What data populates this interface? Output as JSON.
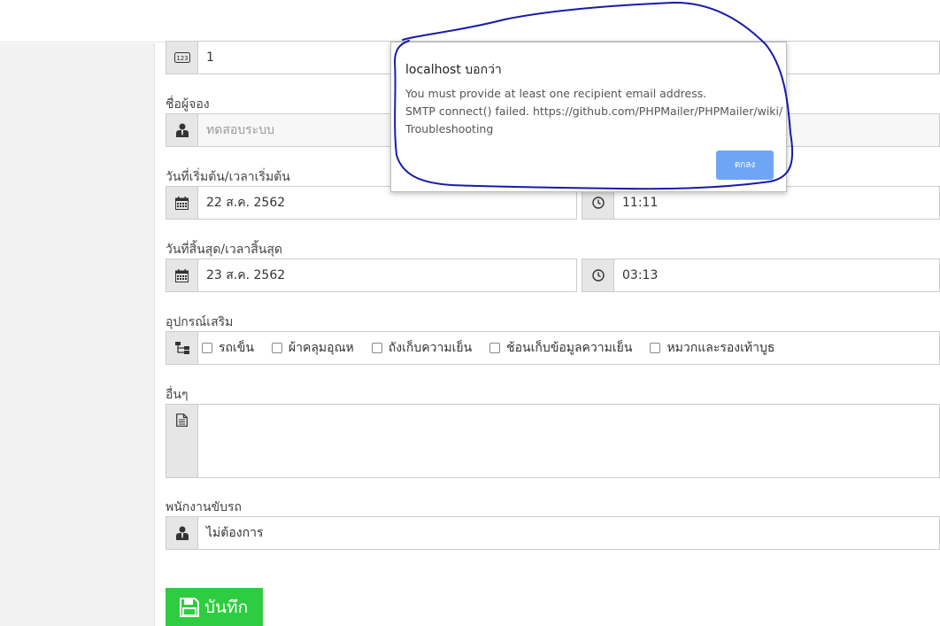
{
  "form": {
    "id_value": "1",
    "booker": {
      "label": "ชื่อผู้จอง",
      "placeholder": "ทดสอบระบบ"
    },
    "start": {
      "label": "วันที่เริ่มต้น/เวลาเริ่มต้น",
      "date": "22 ส.ค. 2562",
      "time": "11:11"
    },
    "end": {
      "label": "วันที่สิ้นสุด/เวลาสิ้นสุด",
      "date": "23 ส.ค. 2562",
      "time": "03:13"
    },
    "equipment": {
      "label": "อุปกรณ์เสริม",
      "options": [
        "รถเข็น",
        "ผ้าคลุมอุณห",
        "ถังเก็บความเย็น",
        "ช้อนเก็บข้อมูลความเย็น",
        "หมวกและรองเท้าบูธ"
      ]
    },
    "other": {
      "label": "อื่นๆ",
      "value": ""
    },
    "driver": {
      "label": "พนักงานขับรถ",
      "value": "ไม่ต้องการ"
    },
    "save_label": "บันทึก"
  },
  "dialog": {
    "title": "localhost บอกว่า",
    "message_lines": [
      "You must provide at least one recipient email address.",
      "SMTP connect() failed. https://github.com/PHPMailer/PHPMailer/wiki/",
      "Troubleshooting"
    ],
    "ok_label": "ตกลง"
  },
  "colors": {
    "save_button": "#2ecc40",
    "ok_button": "#6ea6f5",
    "annotation_ink": "#1a1aa8",
    "addon_bg": "#e6e6e6"
  },
  "icons": {
    "id": "numbers-123-icon",
    "person": "user-tie-icon",
    "calendar": "calendar-icon",
    "clock": "clock-icon",
    "tree": "sitemap-icon",
    "document": "document-icon",
    "save": "floppy-disk-icon"
  }
}
